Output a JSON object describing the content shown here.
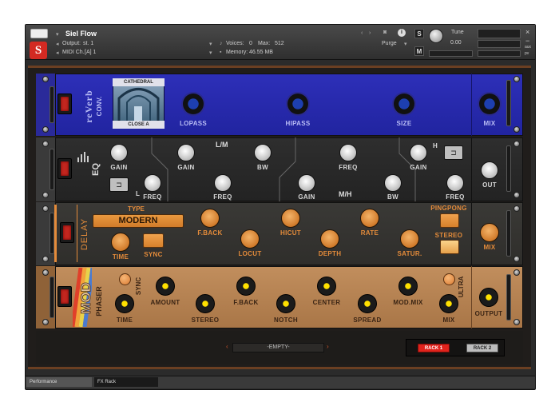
{
  "header": {
    "instrument_name": "Siel Flow",
    "output_label": "Output:",
    "output_value": "st. 1",
    "midi_label": "MIDI Ch.:",
    "midi_value": "[A] 1",
    "voices_label": "Voices:",
    "voices_value": "0",
    "max_label": "Max:",
    "max_value": "512",
    "memory_label": "Memory:",
    "memory_value": "46.55 MB",
    "purge_label": "Purge",
    "tune_label": "Tune",
    "tune_value": "0.00",
    "s_label": "S",
    "m_label": "M",
    "close_glyph": "×",
    "minimize_glyph": "−",
    "aux_label": "aux",
    "pv_label": "pv"
  },
  "reverb": {
    "name_line1": "reVerb",
    "name_line2": "CONV.",
    "preset_top": "CATHEDRAL",
    "preset_bottom": "CLOSE A",
    "knobs": [
      "LOPASS",
      "HIPASS",
      "SIZE",
      "MIX"
    ]
  },
  "eq": {
    "name": "EQ",
    "lm_label": "L/M",
    "mh_label": "M/H",
    "l_label": "L",
    "h_label": "H",
    "knobs_top": [
      "GAIN",
      "GAIN",
      "BW",
      "FREQ",
      "GAIN"
    ],
    "knobs_bottom": [
      "FREQ",
      "FREQ",
      "GAIN",
      "BW",
      "FREQ"
    ],
    "out_label": "OUT"
  },
  "delay": {
    "name": "DELAY",
    "type_label": "TYPE",
    "type_value": "MODERN",
    "time_label": "TIME",
    "sync_label": "SYNC",
    "knobs_top": [
      "F.BACK",
      "HICUT",
      "RATE"
    ],
    "knobs_bottom": [
      "LOCUT",
      "DEPTH",
      "SATUR."
    ],
    "pingpong_label": "PINGPONG",
    "stereo_label": "STEREO",
    "mix_label": "MIX"
  },
  "phaser": {
    "name_line1": "MOD",
    "name_line2": "PHASER",
    "sync_label": "SYNC",
    "ultra_label": "ULTRA",
    "knobs_top": [
      "AMOUNT",
      "F.BACK",
      "CENTER",
      "MOD.MIX"
    ],
    "knobs_bottom": [
      "TIME",
      "STEREO",
      "NOTCH",
      "SPREAD",
      "MIX"
    ],
    "output_label": "OUTPUT"
  },
  "bottom": {
    "slot_label": "-EMPTY-",
    "rack1_label": "RACK 1",
    "rack2_label": "RACK 2"
  },
  "footer": {
    "tab1": "Performance",
    "tab2": "FX Rack"
  },
  "colors": {
    "reverb_panel": "#2124a0",
    "delay_accent": "#e48b3a",
    "phaser_panel": "#b27e4e",
    "power_red": "#c2261f",
    "rack1_red": "#e0231c"
  }
}
